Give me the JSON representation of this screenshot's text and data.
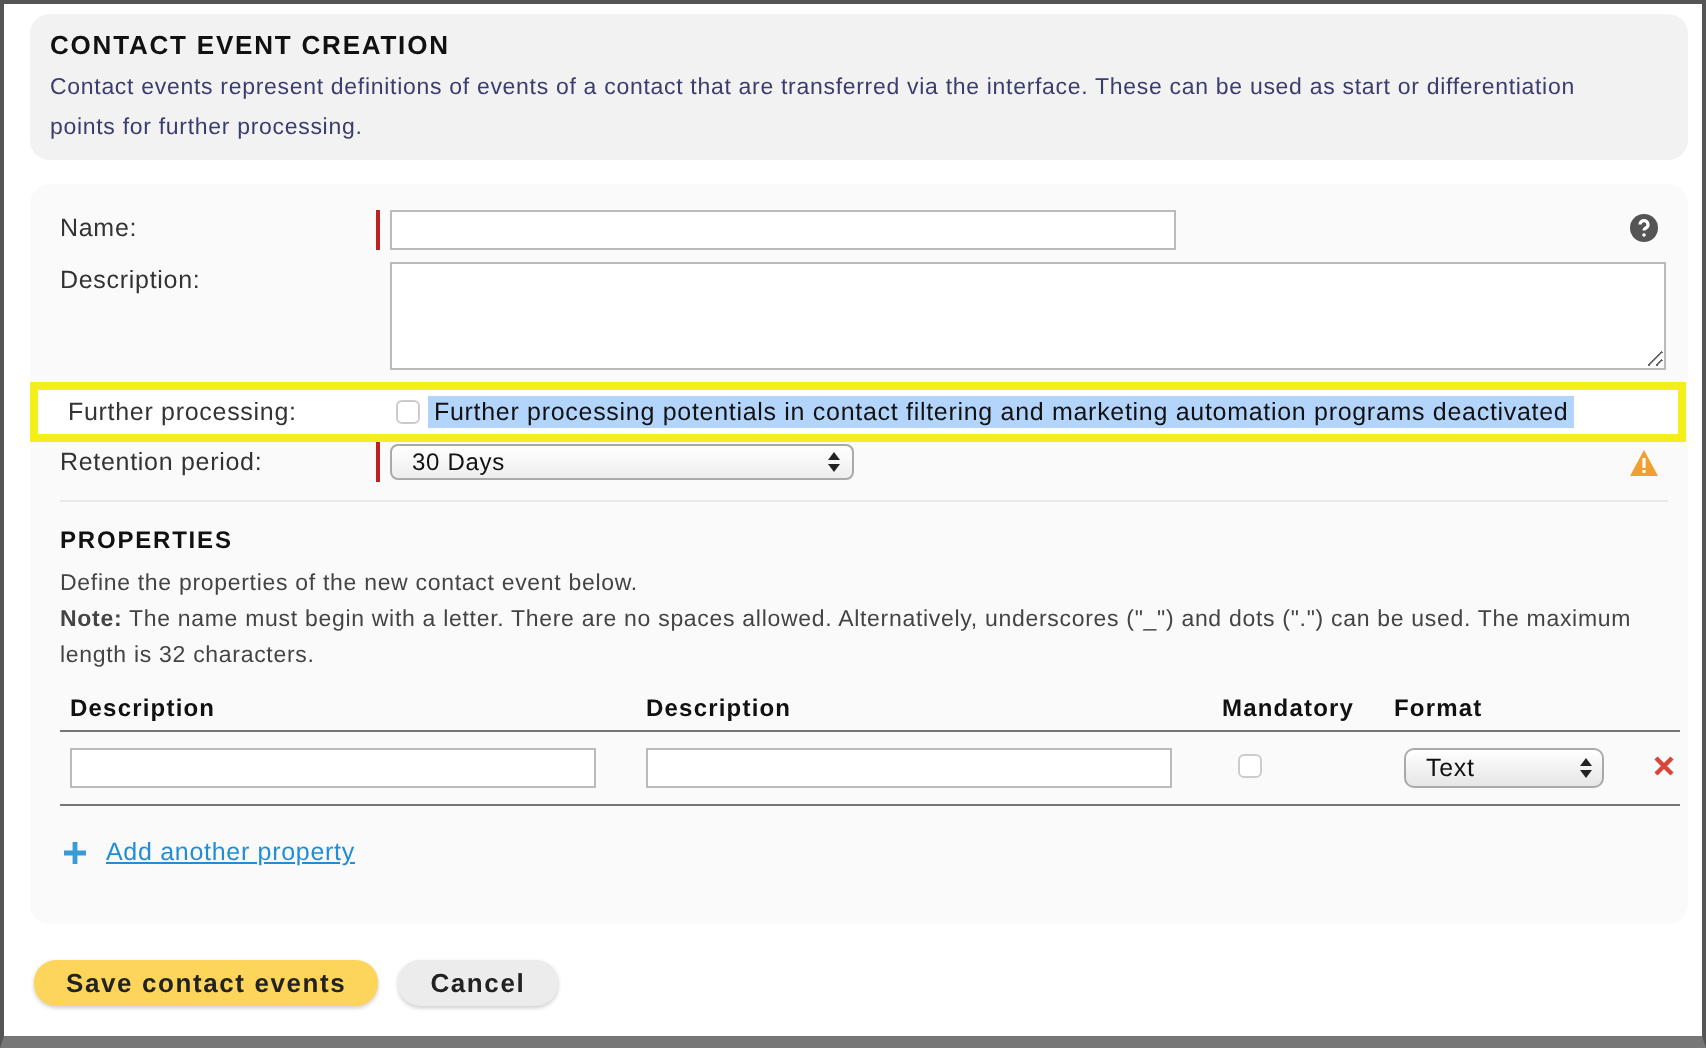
{
  "header": {
    "title": "CONTACT EVENT CREATION",
    "description": "Contact events represent definitions of events of a contact that are transferred via the interface. These can be used as start or differentiation points for further processing."
  },
  "form": {
    "name": {
      "label": "Name:",
      "required": true
    },
    "description": {
      "label": "Description:"
    },
    "further_processing": {
      "label": "Further processing:",
      "checked": false,
      "option_text": "Further processing potentials in contact filtering and marketing automation programs deactivated",
      "text_selected": true,
      "highlighted": true
    },
    "retention_period": {
      "label": "Retention period:",
      "value": "30 Days",
      "required": true,
      "warning": true
    }
  },
  "properties": {
    "title": "PROPERTIES",
    "intro": "Define the properties of the new contact event below.",
    "note": "**Note:** The name must begin with a letter. There are no spaces allowed. Alternatively, underscores (\"_\") and dots (\".\") can be used. The maximum length is 32 characters.",
    "columns": [
      "Description",
      "Description",
      "Mandatory",
      "Format"
    ],
    "rows": [
      {
        "mandatory": false,
        "format": "Text"
      }
    ],
    "add_link": "Add another property"
  },
  "buttons": [
    {
      "label": "Save contact events",
      "kind": "primary"
    },
    {
      "label": "Cancel",
      "kind": "secondary"
    }
  ]
}
